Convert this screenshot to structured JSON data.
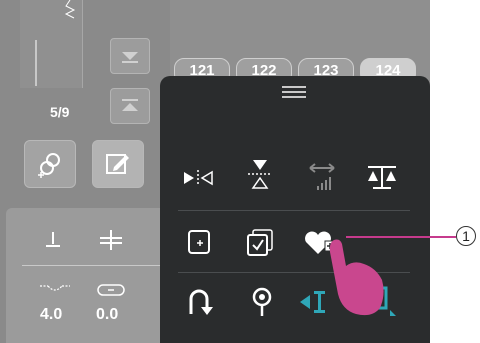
{
  "stitch_counter": "5/9",
  "tabs": [
    "121",
    "122",
    "123",
    "124"
  ],
  "left_values": {
    "stitch_length": "4.0",
    "stitch_width": "0.0"
  },
  "callout": "1",
  "icons": [
    "mirror-horizontal-icon",
    "mirror-vertical-icon",
    "stitch-density-icon",
    "balance-icon",
    "add-pattern-icon",
    "check-pattern-icon",
    "favorite-add-icon",
    "reverse-icon",
    "needle-stop-icon",
    "start-end-left-icon",
    "start-end-right-icon"
  ],
  "colors": {
    "accent_teal": "#2fa7b8",
    "callout_magenta": "#c63b8d"
  }
}
